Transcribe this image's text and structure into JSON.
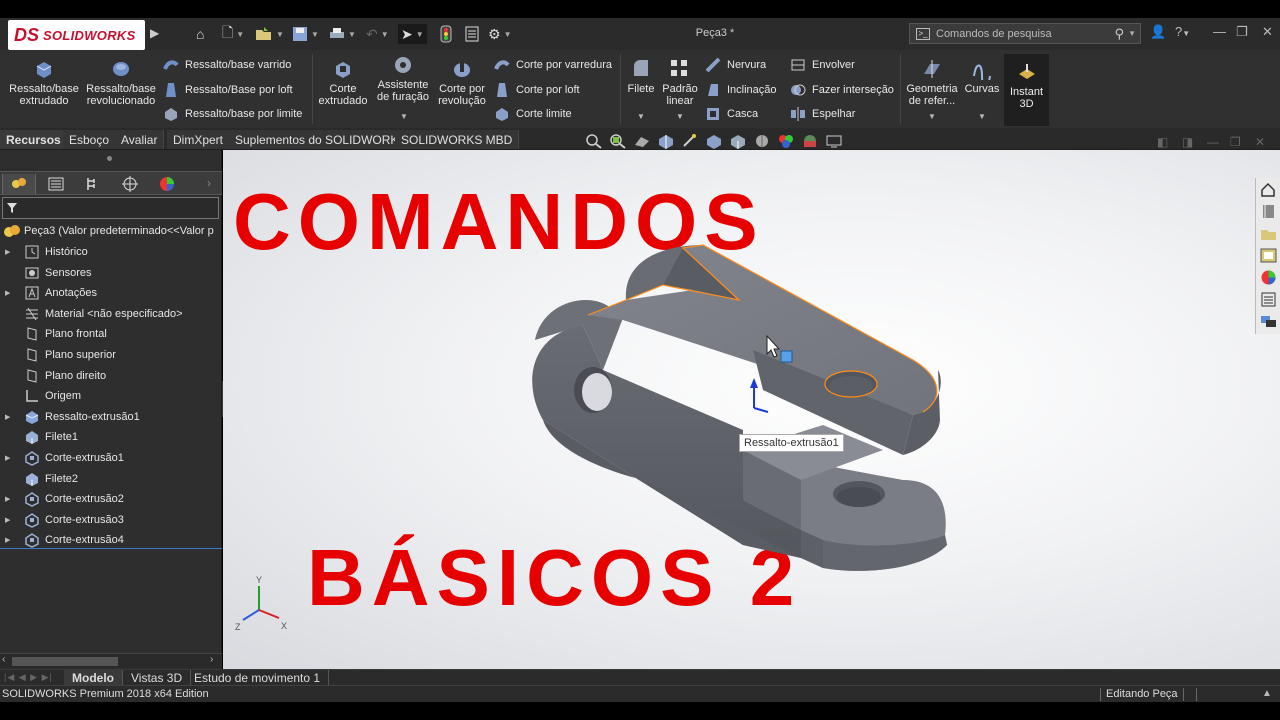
{
  "app": {
    "logo_mark": "DS",
    "logo_text": "SOLIDWORKS",
    "document_title": "Peça3 *"
  },
  "search": {
    "placeholder": "Comandos de pesquisa"
  },
  "ribbon": {
    "ressalto_extrudado": "Ressalto/base extrudado",
    "ressalto_revolucionado": "Ressalto/base revolucionado",
    "ressalto_varrido": "Ressalto/base varrido",
    "ressalto_loft": "Ressalto/Base por loft",
    "ressalto_limite": "Ressalto/base por limite",
    "corte_extrudado": "Corte extrudado",
    "assistente_furacao": "Assistente de furação",
    "corte_revolucao": "Corte por revolução",
    "corte_varredura": "Corte por varredura",
    "corte_loft": "Corte por loft",
    "corte_limite": "Corte limite",
    "filete": "Filete",
    "padrao_linear": "Padrão linear",
    "nervura": "Nervura",
    "inclinacao": "Inclinação",
    "casca": "Casca",
    "envolver": "Envolver",
    "fazer_intersecao": "Fazer interseção",
    "espelhar": "Espelhar",
    "geometria_referencia": "Geometria de refer...",
    "curvas": "Curvas",
    "instant3d": "Instant 3D"
  },
  "tabs": [
    "Recursos",
    "Esboço",
    "Avaliar",
    "DimXpert",
    "Suplementos do SOLIDWORKS",
    "SOLIDWORKS MBD"
  ],
  "tree": {
    "root": "Peça3  (Valor predeterminado<<Valor p",
    "items": [
      {
        "label": "Histórico",
        "expandable": true,
        "icon": "history-icon"
      },
      {
        "label": "Sensores",
        "expandable": false,
        "icon": "sensor-icon"
      },
      {
        "label": "Anotações",
        "expandable": true,
        "icon": "annotation-icon"
      },
      {
        "label": "Material <não especificado>",
        "expandable": false,
        "icon": "material-icon"
      },
      {
        "label": "Plano frontal",
        "expandable": false,
        "icon": "plane-icon"
      },
      {
        "label": "Plano superior",
        "expandable": false,
        "icon": "plane-icon"
      },
      {
        "label": "Plano direito",
        "expandable": false,
        "icon": "plane-icon"
      },
      {
        "label": "Origem",
        "expandable": false,
        "icon": "origin-icon"
      },
      {
        "label": "Ressalto-extrusão1",
        "expandable": true,
        "icon": "extrude-icon"
      },
      {
        "label": "Filete1",
        "expandable": false,
        "icon": "fillet-icon"
      },
      {
        "label": "Corte-extrusão1",
        "expandable": true,
        "icon": "cut-extrude-icon"
      },
      {
        "label": "Filete2",
        "expandable": false,
        "icon": "fillet-icon"
      },
      {
        "label": "Corte-extrusão2",
        "expandable": true,
        "icon": "cut-extrude-icon"
      },
      {
        "label": "Corte-extrusão3",
        "expandable": true,
        "icon": "cut-extrude-icon"
      },
      {
        "label": "Corte-extrusão4",
        "expandable": true,
        "icon": "cut-extrude-icon"
      }
    ]
  },
  "graphics": {
    "overlay_line1": "COMANDOS",
    "overlay_line2": "BÁSICOS 2",
    "tooltip": "Ressalto-extrusão1",
    "triad_x": "X",
    "triad_y": "Y",
    "triad_z": "Z"
  },
  "bottom_tabs": [
    "Modelo",
    "Vistas 3D",
    "Estudo de movimento 1"
  ],
  "status": {
    "edition": "SOLIDWORKS Premium 2018 x64 Edition",
    "mode": "Editando Peça"
  },
  "colors": {
    "brand_red": "#c8102e",
    "overlay_red": "#e60000",
    "part_gray": "#72747c",
    "selection_orange": "#ff8c1a"
  }
}
